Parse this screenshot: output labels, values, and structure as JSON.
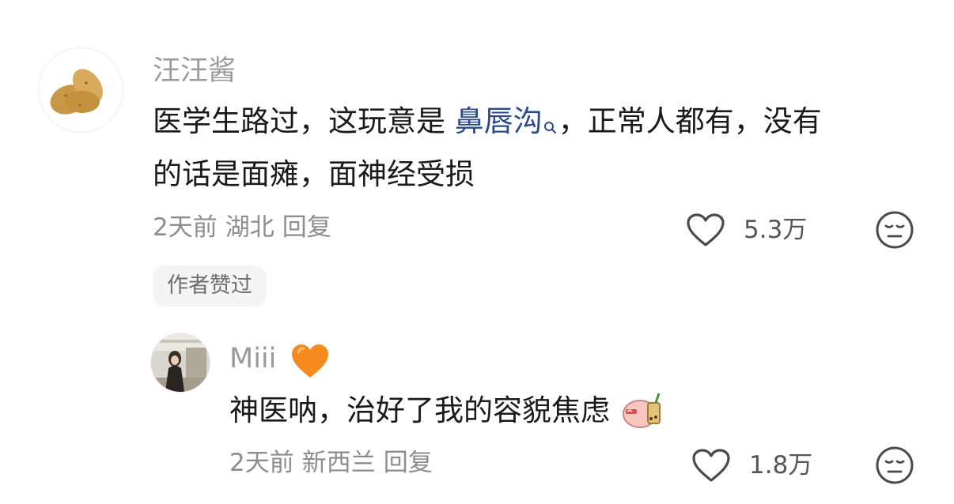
{
  "comment": {
    "username": "汪汪酱",
    "text_before": "医学生路过，这玩意是 ",
    "keyword": "鼻唇沟",
    "text_after": "，正常人都有，没有",
    "text_line2": "的话是面瘫，面神经受损",
    "time": "2天前",
    "location": "湖北",
    "reply_label": "回复",
    "likes": "5.3万",
    "author_tag": "作者赞过"
  },
  "reply": {
    "username": "Miii",
    "badge_icon": "orange-heart-icon",
    "text": "神医呐，治好了我的容貌焦虑",
    "sticker_icon": "bubble-tea-sticker-icon",
    "time": "2天前",
    "location": "新西兰",
    "reply_label": "回复",
    "likes": "1.8万"
  },
  "colors": {
    "keyword": "#2b4a8b",
    "username": "#9a9a9a",
    "text": "#1a1a1a",
    "meta": "#8d8d8d",
    "orange_heart": "#f58a1f"
  }
}
